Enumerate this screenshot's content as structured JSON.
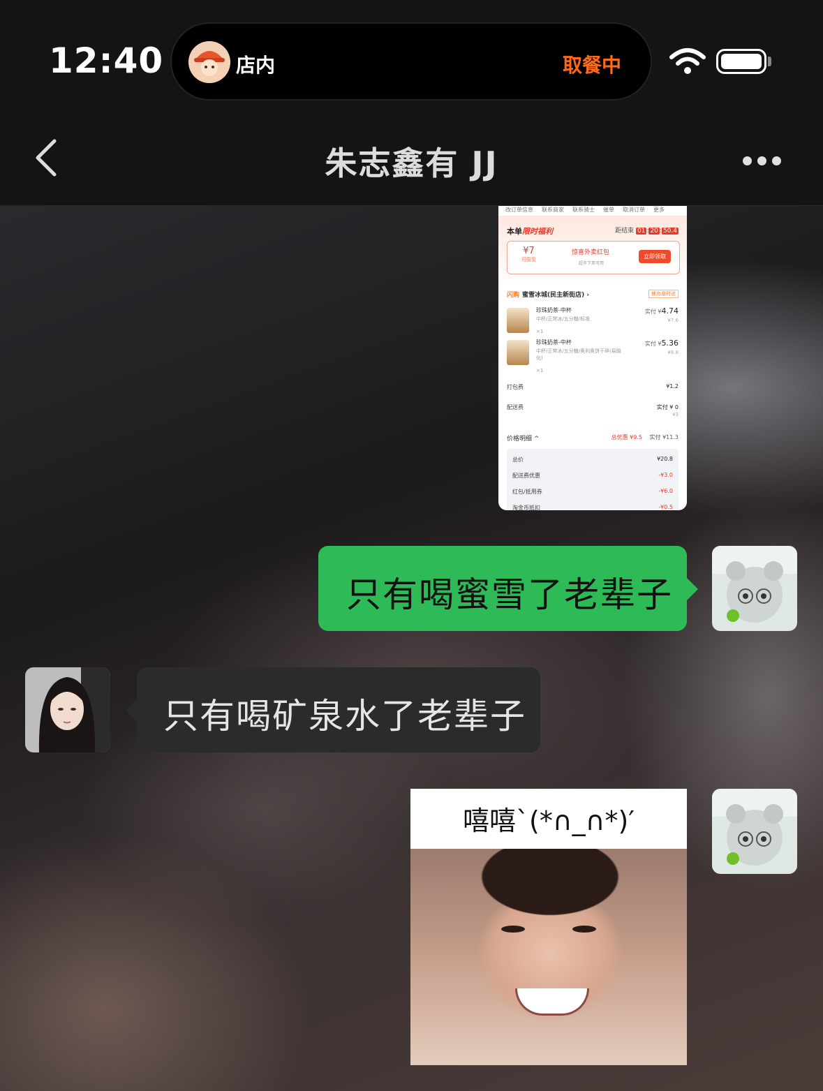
{
  "status_bar": {
    "time": "12:40",
    "live_activity": {
      "label": "店内",
      "status": "取餐中",
      "status_color": "#ff6a1a",
      "avatar_icon": "delivery-rider-avatar"
    },
    "wifi_icon": "wifi-icon",
    "battery_icon": "battery-icon"
  },
  "nav": {
    "title": "朱志鑫有 JJ",
    "back_icon": "chevron-left-icon",
    "more_icon": "more-dots-icon"
  },
  "messages": [
    {
      "sender": "me",
      "type": "image",
      "image": {
        "tabs": [
          "改订单信息",
          "联系商家",
          "联系骑士",
          "催单",
          "取消订单",
          "更多"
        ],
        "benefit_title_prefix": "本单",
        "benefit_title_em": "限时福利",
        "countdown_label": "距结束",
        "countdown_values": [
          "01",
          "20",
          "50.4"
        ],
        "coupon_amount": "¥7",
        "coupon_amount_sub": "可膨至",
        "coupon_name": "惊喜外卖红包",
        "coupon_sub": "超市下单可用",
        "coupon_button": "立即领取",
        "store_tag": "闪购",
        "store_name": "蜜雪冰城(民主新街店) ›",
        "store_badge": "蜂鸟准时达",
        "items": [
          {
            "name": "珍珠奶茶-中杯",
            "spec": "中杯/正常冰/五分糖/标准",
            "qty": "×1",
            "paid_label": "实付 ¥",
            "paid": "4.74",
            "original": "¥7.6"
          },
          {
            "name": "珍珠奶茶-中杯",
            "spec": "中杯/正常冰/五分糖/奥利奥饼干碎(易融化)",
            "qty": "×1",
            "paid_label": "实付 ¥",
            "paid": "5.36",
            "original": "¥8.8"
          }
        ],
        "packing_label": "打包费",
        "packing_value": "¥1.2",
        "delivery_label": "配送费",
        "delivery_value": "实付 ¥ 0",
        "delivery_original": "¥3",
        "price_detail_label": "价格明细 ^",
        "total_discount": "总优惠 ¥9.5",
        "total_paid": "实付 ¥11.3",
        "detail_rows": [
          {
            "label": "总价",
            "value": "¥20.8",
            "red": false
          },
          {
            "label": "配送费优惠",
            "value": "-¥3.0",
            "red": true
          },
          {
            "label": "红包/抵用券",
            "value": "-¥6.0",
            "red": true
          },
          {
            "label": "淘金币抵扣",
            "value": "-¥0.5",
            "red": true
          }
        ]
      }
    },
    {
      "sender": "me",
      "type": "text",
      "text": "只有喝蜜雪了老辈子",
      "bubble_color": "#2fba58"
    },
    {
      "sender": "her",
      "type": "text",
      "text": "只有喝矿泉水了老辈子",
      "bubble_color": "#2b2b2d"
    },
    {
      "sender": "me",
      "type": "sticker",
      "caption": "嘻嘻`(*∩_∩*)′"
    }
  ]
}
